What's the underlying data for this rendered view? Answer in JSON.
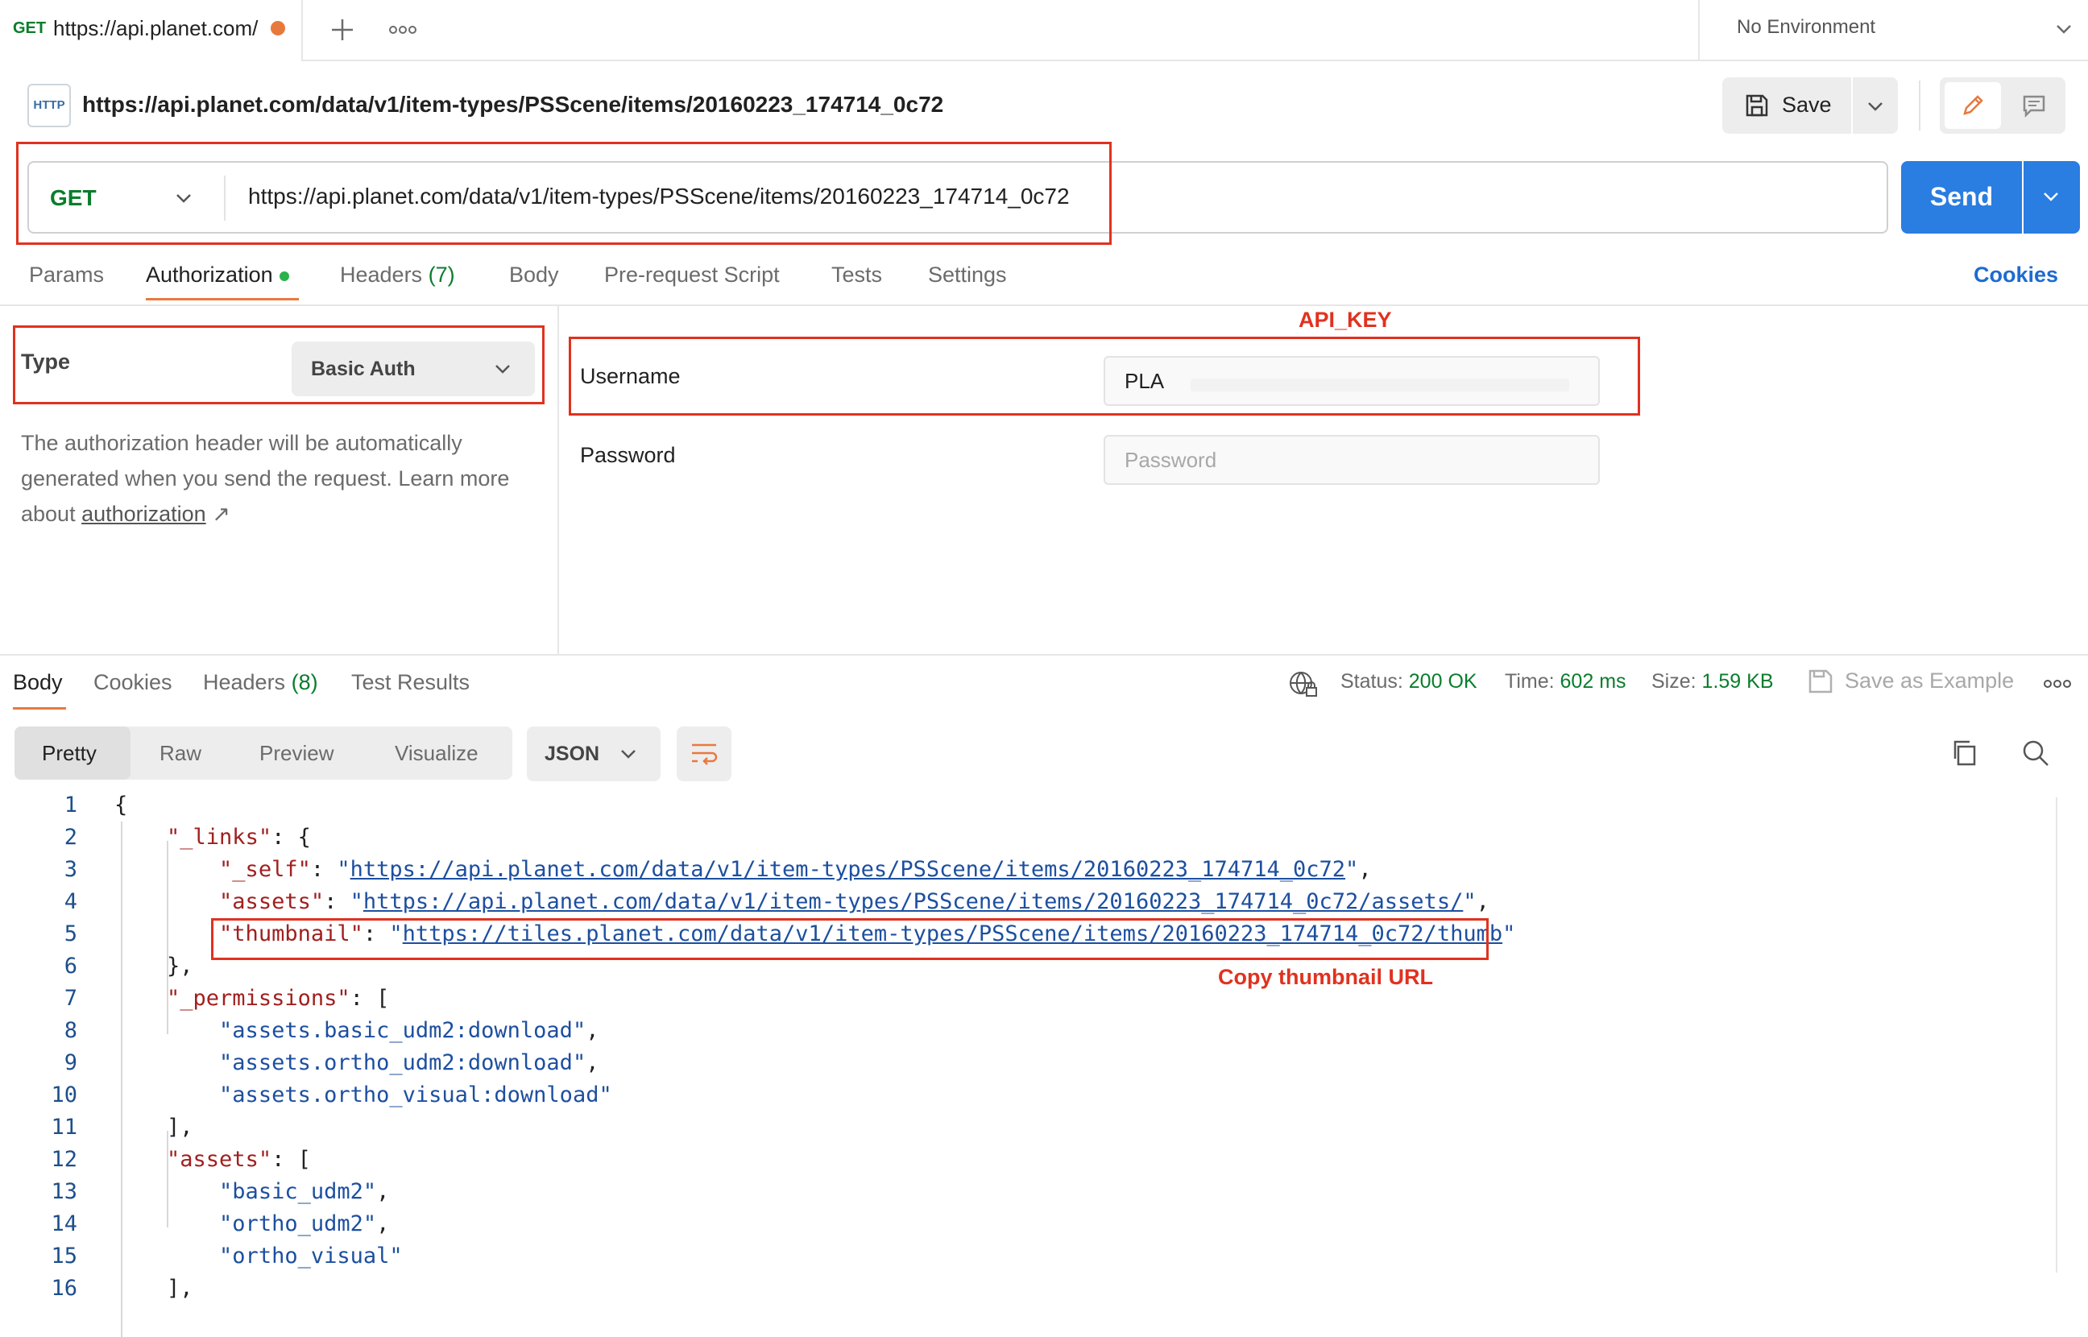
{
  "tab": {
    "method": "GET",
    "title": "https://api.planet.com/"
  },
  "environment": {
    "label": "No Environment"
  },
  "request": {
    "title": "https://api.planet.com/data/v1/item-types/PSScene/items/20160223_174714_0c72",
    "method": "GET",
    "url": "https://api.planet.com/data/v1/item-types/PSScene/items/20160223_174714_0c72",
    "save_label": "Save",
    "send_label": "Send",
    "http_icon_text": "HTTP"
  },
  "request_tabs": {
    "params": "Params",
    "authorization": "Authorization",
    "headers": "Headers",
    "headers_count": "(7)",
    "body": "Body",
    "prerequest": "Pre-request Script",
    "tests": "Tests",
    "settings": "Settings",
    "cookies": "Cookies"
  },
  "auth": {
    "type_label": "Type",
    "type_value": "Basic Auth",
    "help_text": "The authorization header will be automatically generated when you send the request. Learn more about ",
    "help_link": "authorization",
    "username_label": "Username",
    "username_value": "PLA",
    "password_label": "Password",
    "password_placeholder": "Password"
  },
  "annotations": {
    "api_key": "API_KEY",
    "copy_thumbnail": "Copy thumbnail URL"
  },
  "response_tabs": {
    "body": "Body",
    "cookies": "Cookies",
    "headers": "Headers",
    "headers_count": "(8)",
    "test_results": "Test Results"
  },
  "response_stats": {
    "status_label": "Status:",
    "status_value": "200 OK",
    "time_label": "Time:",
    "time_value": "602 ms",
    "size_label": "Size:",
    "size_value": "1.59 KB",
    "save_example": "Save as Example"
  },
  "formats": {
    "pretty": "Pretty",
    "raw": "Raw",
    "preview": "Preview",
    "visualize": "Visualize",
    "lang": "JSON"
  },
  "json_lines": {
    "n": [
      "1",
      "2",
      "3",
      "4",
      "5",
      "6",
      "7",
      "8",
      "9",
      "10",
      "11",
      "12",
      "13",
      "14",
      "15",
      "16"
    ],
    "links_key": "\"_links\"",
    "self_key": "\"_self\"",
    "self_url": "https://api.planet.com/data/v1/item-types/PSScene/items/20160223_174714_0c72",
    "assets_key": "\"assets\"",
    "assets_url": "https://api.planet.com/data/v1/item-types/PSScene/items/20160223_174714_0c72/assets/",
    "thumb_key": "\"thumbnail\"",
    "thumb_url": "https://tiles.planet.com/data/v1/item-types/PSScene/items/20160223_174714_0c72/thumb",
    "perm_key": "\"_permissions\"",
    "perm_1": "\"assets.basic_udm2:download\"",
    "perm_2": "\"assets.ortho_udm2:download\"",
    "perm_3": "\"assets.ortho_visual:download\"",
    "assets_list_key": "\"assets\"",
    "asset_1": "\"basic_udm2\"",
    "asset_2": "\"ortho_udm2\"",
    "asset_3": "\"ortho_visual\""
  },
  "colors": {
    "accent_orange": "#e8793d",
    "send_blue": "#2a7de1",
    "success_green": "#0a7d2c",
    "annotation_red": "#e0321f"
  }
}
